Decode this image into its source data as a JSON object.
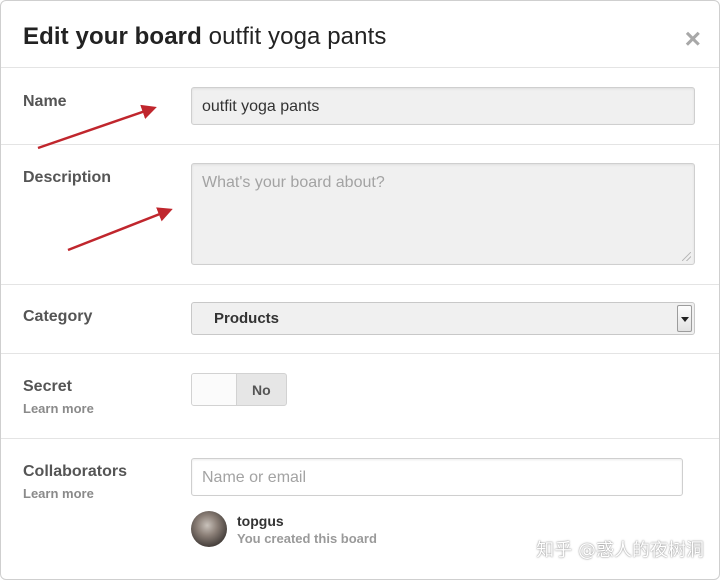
{
  "dialog": {
    "title_bold": "Edit your board",
    "title_board_name": "outfit yoga pants",
    "close_label": "×"
  },
  "name": {
    "label": "Name",
    "value": "outfit yoga pants"
  },
  "description": {
    "label": "Description",
    "placeholder": "What's your board about?"
  },
  "category": {
    "label": "Category",
    "selected": "Products"
  },
  "secret": {
    "label": "Secret",
    "learn_more": "Learn more",
    "toggle_state": "No"
  },
  "collaborators": {
    "label": "Collaborators",
    "learn_more": "Learn more",
    "placeholder": "Name or email",
    "creator_name": "topgus",
    "creator_note": "You created this board"
  },
  "watermark": "知乎 @惑人的夜树洞",
  "colors": {
    "annotation_arrow": "#c0262d",
    "field_bg": "#f0f0f0",
    "divider": "#e4e4e4"
  }
}
